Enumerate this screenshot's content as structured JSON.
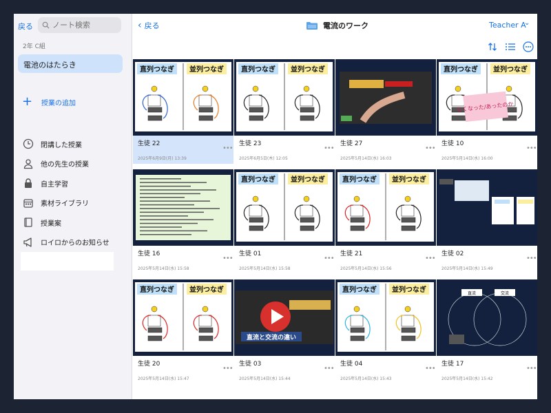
{
  "sidebar": {
    "back_label": "戻る",
    "search_placeholder": "ノート検索",
    "class_name": "2年 C組",
    "selected_lesson": "電池のはたらき",
    "add_lesson": "授業の追加",
    "menu": [
      {
        "label": "閉講した授業",
        "icon": "clock-icon"
      },
      {
        "label": "他の先生の授業",
        "icon": "person-icon"
      },
      {
        "label": "自主学習",
        "icon": "lock-icon"
      },
      {
        "label": "素材ライブラリ",
        "icon": "calendar-icon"
      },
      {
        "label": "授業案",
        "icon": "book-icon"
      },
      {
        "label": "ロイロからのお知らせ",
        "icon": "megaphone-icon"
      }
    ]
  },
  "header": {
    "back_label": "戻る",
    "title": "電流のワーク",
    "teacher": "Teacher A"
  },
  "thumb_text": {
    "series": "直列つなぎ",
    "parallel": "並列つなぎ",
    "note": "なくなった/あったのか",
    "dc_ac": "直流と交流の違い",
    "dc": "直流",
    "ac": "交流"
  },
  "cards": [
    {
      "name": "生徒 22",
      "date": "2025年6月9日(月) 13:39",
      "thumb": "circuit",
      "selected": true
    },
    {
      "name": "生徒 23",
      "date": "2025年6月5日(木) 12:05",
      "thumb": "circuit"
    },
    {
      "name": "生徒 27",
      "date": "2025年5月14日(水) 16:03",
      "thumb": "photo"
    },
    {
      "name": "生徒 10",
      "date": "2025年5月14日(水) 16:00",
      "thumb": "note"
    },
    {
      "name": "生徒 16",
      "date": "2025年5月14日(水) 15:58",
      "thumb": "text"
    },
    {
      "name": "生徒 01",
      "date": "2025年5月14日(水) 15:58",
      "thumb": "circuit"
    },
    {
      "name": "生徒 21",
      "date": "2025年5月14日(水) 15:56",
      "thumb": "circuit"
    },
    {
      "name": "生徒 02",
      "date": "2025年5月14日(水) 15:49",
      "thumb": "board"
    },
    {
      "name": "生徒 20",
      "date": "2025年5月14日(水) 15:47",
      "thumb": "circuit"
    },
    {
      "name": "生徒 03",
      "date": "2025年5月14日(水) 15:44",
      "thumb": "video"
    },
    {
      "name": "生徒 04",
      "date": "2025年5月14日(水) 15:43",
      "thumb": "circuit"
    },
    {
      "name": "生徒 17",
      "date": "2025年5月14日(水) 15:42",
      "thumb": "venn"
    }
  ]
}
